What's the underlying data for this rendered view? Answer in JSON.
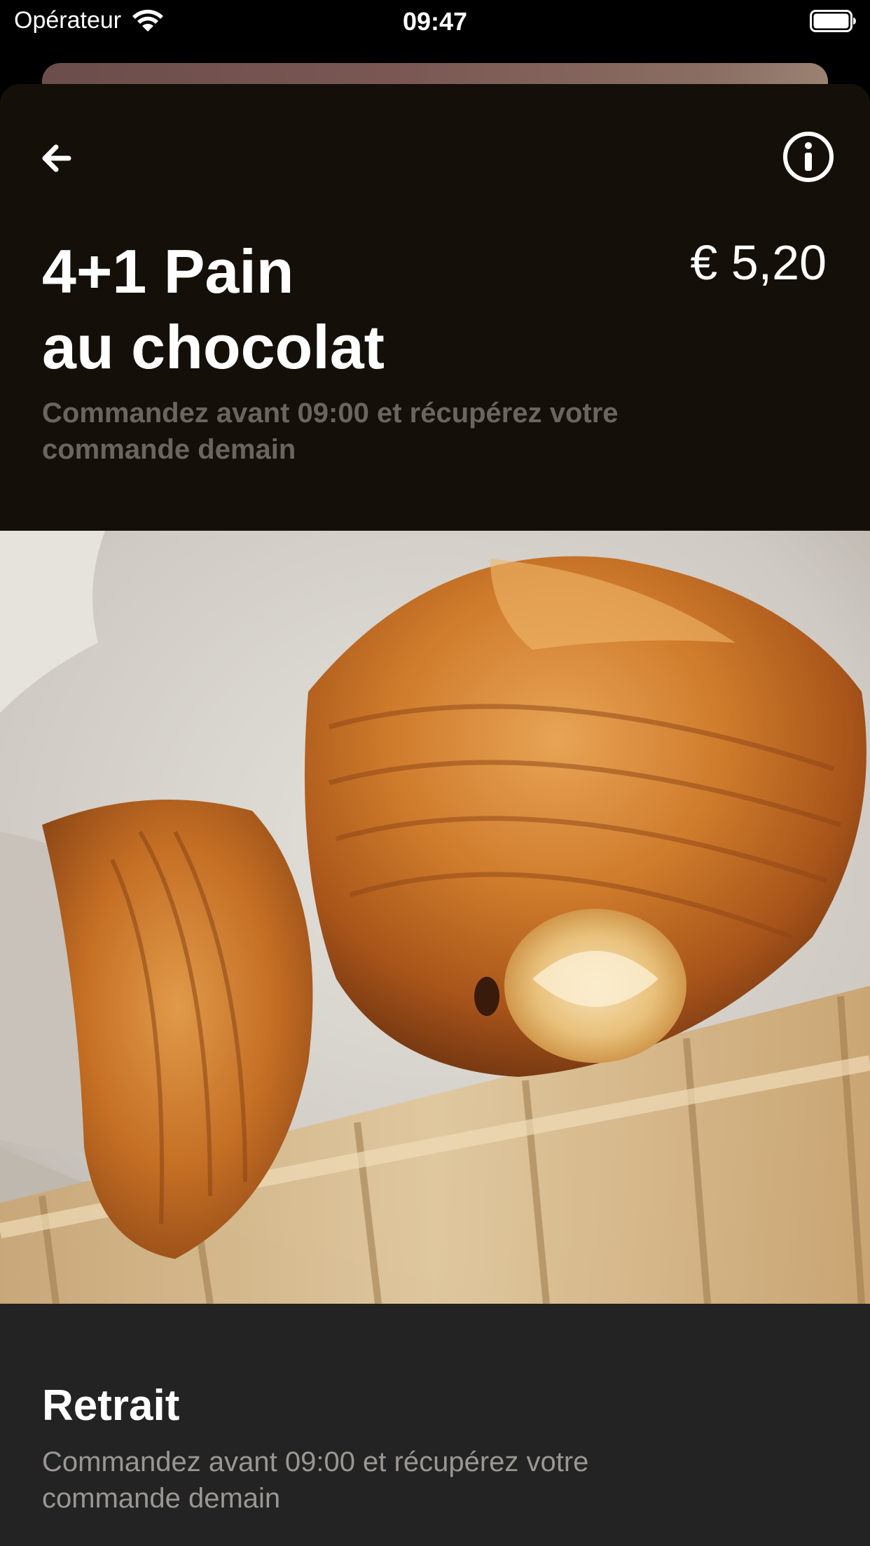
{
  "status_bar": {
    "carrier": "Opérateur",
    "time": "09:47"
  },
  "icons": {
    "wifi": "wifi-icon",
    "battery": "battery-icon",
    "back": "arrow-left-icon",
    "info": "info-icon"
  },
  "product": {
    "title_line1": "4+1 Pain",
    "title_line2": "au chocolat",
    "price": "€ 5,20",
    "subtitle_line1": "Commandez avant 09:00 et récupérez votre",
    "subtitle_line2": "commande demain"
  },
  "pickup": {
    "title": "Retrait",
    "text_line1": "Commandez avant 09:00 et récupérez votre",
    "text_line2": "commande demain"
  },
  "colors": {
    "header_background": "#141009",
    "section_background": "#232323",
    "subtitle_text": "#6a6560",
    "body_text": "#9a9793"
  }
}
